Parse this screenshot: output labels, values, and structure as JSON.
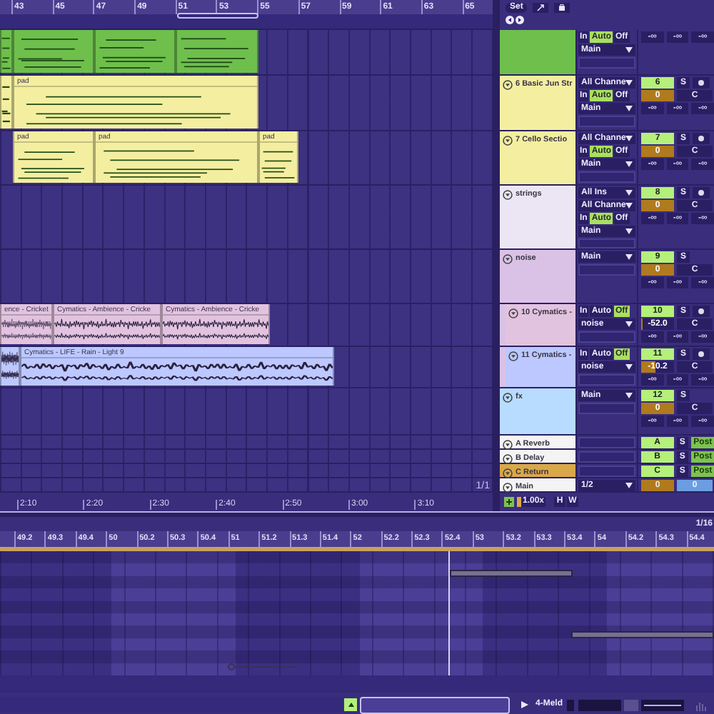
{
  "ruler": {
    "bars": [
      "43",
      "45",
      "47",
      "49",
      "51",
      "53",
      "55",
      "57",
      "59",
      "61",
      "63",
      "65"
    ]
  },
  "toolbar": {
    "set": "Set"
  },
  "tracks": [
    {
      "color": "#6ebf4c",
      "clips": [
        {
          "kind": "midi"
        },
        {
          "kind": "midi"
        },
        {
          "kind": "midi"
        },
        {
          "kind": "midi"
        }
      ],
      "io": [
        {
          "kind": "monitor",
          "buttons": [
            {
              "label": "In",
              "selected": false
            },
            {
              "label": "Auto",
              "selected": true
            },
            {
              "label": "Off",
              "selected": false
            }
          ]
        },
        {
          "kind": "select",
          "value": "Main"
        },
        {
          "kind": "field"
        }
      ],
      "mixer": [
        {
          "kind": "sends",
          "values": [
            "-∞",
            "-∞",
            "-∞"
          ]
        }
      ]
    },
    {
      "name": "6 Basic Jun Str",
      "color": "#f4eea0",
      "clips": [
        {
          "kind": "midi"
        },
        {
          "kind": "midi",
          "name": "pad"
        }
      ],
      "io": [
        {
          "kind": "select",
          "value": "All Channe"
        },
        {
          "kind": "monitor",
          "buttons": [
            {
              "label": "In",
              "selected": false
            },
            {
              "label": "Auto",
              "selected": true
            },
            {
              "label": "Off",
              "selected": false
            }
          ]
        },
        {
          "kind": "select",
          "value": "Main"
        },
        {
          "kind": "field"
        }
      ],
      "mixer": [
        {
          "kind": "track",
          "number": "6",
          "solo": "S",
          "arm": true
        },
        {
          "kind": "volume",
          "value": "0",
          "level": 1,
          "pan": "C"
        },
        {
          "kind": "sends",
          "values": [
            "-∞",
            "-∞",
            "-∞"
          ]
        }
      ]
    },
    {
      "name": "7 Cello Sectio",
      "color": "#f4eea0",
      "clips": [
        {
          "kind": "midi",
          "name": "pad"
        },
        {
          "kind": "midi",
          "name": "pad"
        },
        {
          "kind": "midi",
          "name": "pad"
        }
      ],
      "io": [
        {
          "kind": "select",
          "value": "All Channe"
        },
        {
          "kind": "monitor",
          "buttons": [
            {
              "label": "In",
              "selected": false
            },
            {
              "label": "Auto",
              "selected": true
            },
            {
              "label": "Off",
              "selected": false
            }
          ]
        },
        {
          "kind": "select",
          "value": "Main"
        },
        {
          "kind": "field"
        }
      ],
      "mixer": [
        {
          "kind": "track",
          "number": "7",
          "solo": "S",
          "arm": true
        },
        {
          "kind": "volume",
          "value": "0",
          "level": 1,
          "pan": "C"
        },
        {
          "kind": "sends",
          "values": [
            "-∞",
            "-∞",
            "-∞"
          ]
        }
      ]
    },
    {
      "name": "strings",
      "color": "#ece6f4",
      "io": [
        {
          "kind": "select",
          "value": "All Ins"
        },
        {
          "kind": "select",
          "value": "All Channe"
        },
        {
          "kind": "monitor",
          "buttons": [
            {
              "label": "In",
              "selected": false
            },
            {
              "label": "Auto",
              "selected": true
            },
            {
              "label": "Off",
              "selected": false
            }
          ]
        },
        {
          "kind": "select",
          "value": "Main"
        },
        {
          "kind": "field"
        }
      ],
      "mixer": [
        {
          "kind": "track",
          "number": "8",
          "solo": "S",
          "arm": true
        },
        {
          "kind": "volume",
          "value": "0",
          "level": 1,
          "pan": "C"
        },
        {
          "kind": "sends",
          "values": [
            "-∞",
            "-∞",
            "-∞"
          ]
        }
      ]
    },
    {
      "name": "noise",
      "color": "#d9c2e6",
      "io": [
        {
          "kind": "select",
          "value": "Main"
        },
        {
          "kind": "field"
        }
      ],
      "mixer": [
        {
          "kind": "track",
          "number": "9",
          "solo": "S",
          "arm": false
        },
        {
          "kind": "volume",
          "value": "0",
          "level": 1,
          "pan": "C"
        },
        {
          "kind": "sends",
          "values": [
            "-∞",
            "-∞",
            "-∞"
          ]
        }
      ],
      "children": [
        {
          "name": "10 Cymatics -",
          "color": "#e2c3df",
          "clips": [
            {
              "kind": "audio",
              "name": "ence - Cricket"
            },
            {
              "kind": "audio",
              "name": "Cymatics - Ambience - Cricke"
            },
            {
              "kind": "audio",
              "name": "Cymatics - Ambience - Cricke"
            }
          ],
          "io": [
            {
              "kind": "monitor",
              "buttons": [
                {
                  "label": "In",
                  "selected": false
                },
                {
                  "label": "Auto",
                  "selected": false
                },
                {
                  "label": "Off",
                  "selected": true
                }
              ]
            },
            {
              "kind": "select",
              "value": "noise"
            },
            {
              "kind": "field"
            }
          ],
          "mixer": [
            {
              "kind": "track",
              "number": "10",
              "solo": "S",
              "arm": true
            },
            {
              "kind": "volume",
              "value": "-52.0",
              "level": 0.05,
              "pan": "C"
            },
            {
              "kind": "sends",
              "values": [
                "-∞",
                "-∞",
                "-∞"
              ]
            }
          ]
        },
        {
          "name": "11 Cymatics -",
          "color": "#bcc8ff",
          "clips": [
            {
              "kind": "audio"
            },
            {
              "kind": "audio",
              "name": "Cymatics - LIFE - Rain - Light 9"
            }
          ],
          "io": [
            {
              "kind": "monitor",
              "buttons": [
                {
                  "label": "In",
                  "selected": false
                },
                {
                  "label": "Auto",
                  "selected": false
                },
                {
                  "label": "Off",
                  "selected": true
                }
              ]
            },
            {
              "kind": "select",
              "value": "noise"
            },
            {
              "kind": "field"
            }
          ],
          "mixer": [
            {
              "kind": "track",
              "number": "11",
              "solo": "S",
              "arm": true
            },
            {
              "kind": "volume",
              "value": "-10.2",
              "level": 0.45,
              "pan": "C"
            },
            {
              "kind": "sends",
              "values": [
                "-∞",
                "-∞",
                "-∞"
              ]
            }
          ]
        }
      ]
    },
    {
      "name": "fx",
      "color": "#b8dcff",
      "io": [
        {
          "kind": "select",
          "value": "Main"
        },
        {
          "kind": "field"
        }
      ],
      "mixer": [
        {
          "kind": "track",
          "number": "12",
          "solo": "S",
          "arm": false
        },
        {
          "kind": "volume",
          "value": "0",
          "level": 1,
          "pan": "C"
        },
        {
          "kind": "sends",
          "values": [
            "-∞",
            "-∞",
            "-∞"
          ]
        }
      ]
    },
    {
      "name": "A Reverb",
      "color": "#f4f4f4",
      "io": [
        {
          "kind": "field"
        }
      ],
      "mixer": [
        {
          "kind": "return",
          "letter": "A",
          "solo": "S",
          "post": "Post"
        }
      ]
    },
    {
      "name": "B Delay",
      "color": "#f4f4f4",
      "io": [
        {
          "kind": "field"
        }
      ],
      "mixer": [
        {
          "kind": "return",
          "letter": "B",
          "solo": "S",
          "post": "Post"
        }
      ]
    },
    {
      "name": "C Return",
      "color": "#d9a84a",
      "io": [
        {
          "kind": "field"
        }
      ],
      "mixer": [
        {
          "kind": "return",
          "letter": "C",
          "solo": "S",
          "post": "Post"
        }
      ]
    },
    {
      "name": "Main",
      "color": "#f4f4f4",
      "io": [
        {
          "kind": "select",
          "value": "1/2"
        }
      ],
      "mixer": [
        {
          "kind": "main",
          "value": "0",
          "pan": "0"
        }
      ]
    }
  ],
  "time_ruler": {
    "labels": [
      "2:10",
      "2:20",
      "2:30",
      "2:40",
      "2:50",
      "3:00",
      "3:10"
    ],
    "zoom": "1/1"
  },
  "mixer_footer": {
    "rate": "1.00x",
    "buttons": [
      "H",
      "W"
    ]
  },
  "detail": {
    "grid": "1/16",
    "beats": [
      "49.2",
      "49.3",
      "49.4",
      "50",
      "50.2",
      "50.3",
      "50.4",
      "51",
      "51.2",
      "51.3",
      "51.4",
      "52",
      "52.2",
      "52.3",
      "52.4",
      "53",
      "53.2",
      "53.3",
      "53.4",
      "54",
      "54.2",
      "54.3",
      "54.4"
    ]
  },
  "status_bar": {
    "clip_name": "4-Meld"
  }
}
